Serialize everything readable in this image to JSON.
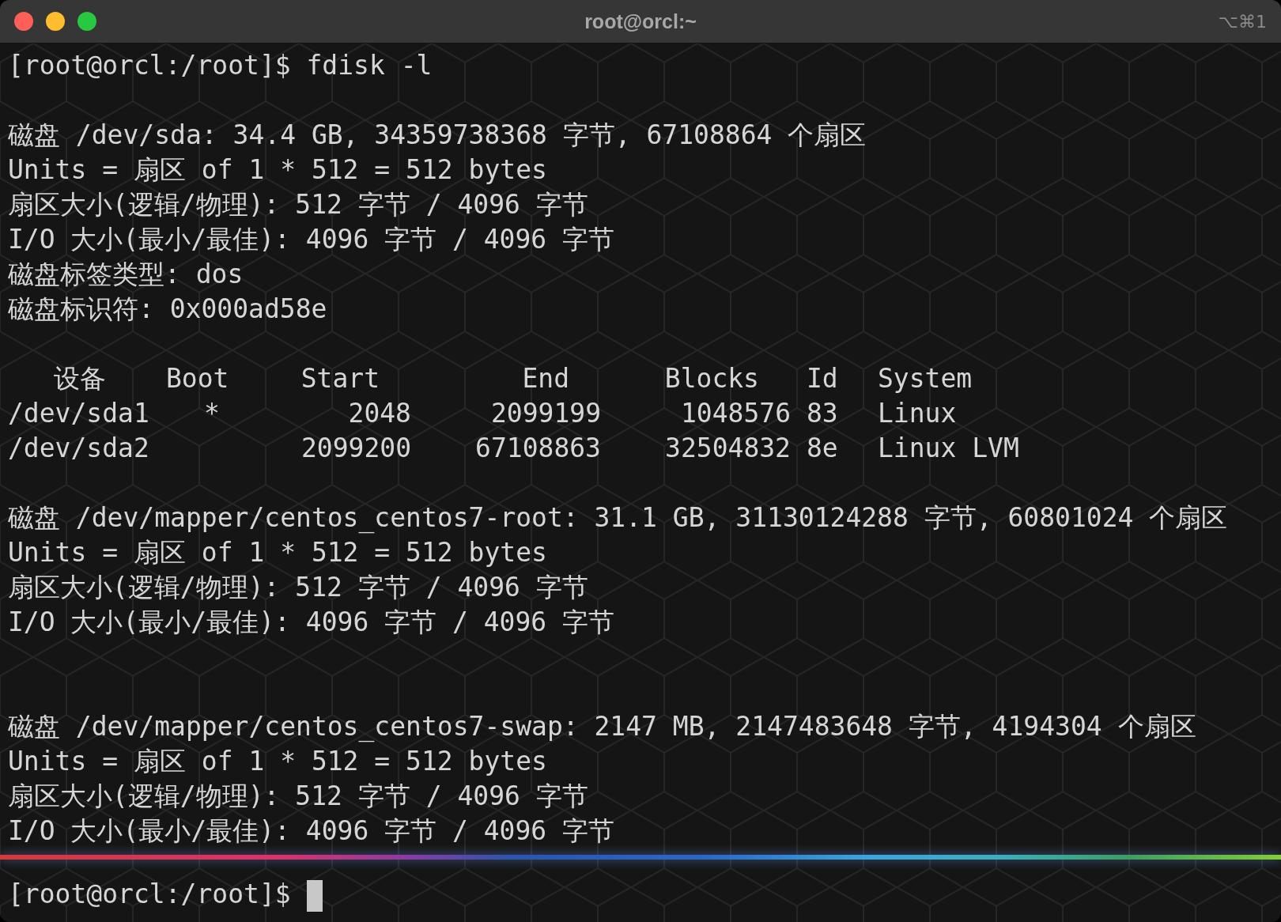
{
  "window": {
    "title": "root@orcl:~",
    "shortcut": "⌥⌘1"
  },
  "lines": [
    {
      "kind": "prompt",
      "prompt": "[root@orcl:/root]$",
      "command": "fdisk -l"
    },
    {
      "kind": "blank"
    },
    {
      "kind": "text",
      "text": "磁盘 /dev/sda: 34.4 GB, 34359738368 字节, 67108864 个扇区"
    },
    {
      "kind": "text",
      "text": "Units = 扇区 of 1 * 512 = 512 bytes"
    },
    {
      "kind": "text",
      "text": "扇区大小(逻辑/物理): 512 字节 / 4096 字节"
    },
    {
      "kind": "text",
      "text": "I/O 大小(最小/最佳): 4096 字节 / 4096 字节"
    },
    {
      "kind": "text",
      "text": "磁盘标签类型: dos"
    },
    {
      "kind": "text",
      "text": "磁盘标识符: 0x000ad58e"
    },
    {
      "kind": "blank"
    },
    {
      "kind": "table",
      "columns": [
        "设备",
        "Boot",
        "Start",
        "End",
        "Blocks",
        "Id",
        "System"
      ],
      "rows": [
        [
          "/dev/sda1",
          "*",
          "2048",
          "2099199",
          "1048576",
          "83",
          "Linux"
        ],
        [
          "/dev/sda2",
          "",
          "2099200",
          "67108863",
          "32504832",
          "8e",
          "Linux LVM"
        ]
      ]
    },
    {
      "kind": "blank"
    },
    {
      "kind": "text",
      "text": "磁盘 /dev/mapper/centos_centos7-root: 31.1 GB, 31130124288 字节, 60801024 个扇区"
    },
    {
      "kind": "text",
      "text": "Units = 扇区 of 1 * 512 = 512 bytes"
    },
    {
      "kind": "text",
      "text": "扇区大小(逻辑/物理): 512 字节 / 4096 字节"
    },
    {
      "kind": "text",
      "text": "I/O 大小(最小/最佳): 4096 字节 / 4096 字节"
    },
    {
      "kind": "blank"
    },
    {
      "kind": "blank"
    },
    {
      "kind": "text",
      "text": "磁盘 /dev/mapper/centos_centos7-swap: 2147 MB, 2147483648 字节, 4194304 个扇区"
    },
    {
      "kind": "text",
      "text": "Units = 扇区 of 1 * 512 = 512 bytes"
    },
    {
      "kind": "text",
      "text": "扇区大小(逻辑/物理): 512 字节 / 4096 字节"
    },
    {
      "kind": "text",
      "text": "I/O 大小(最小/最佳): 4096 字节 / 4096 字节"
    }
  ],
  "input": {
    "prompt": "[root@orcl:/root]$"
  }
}
